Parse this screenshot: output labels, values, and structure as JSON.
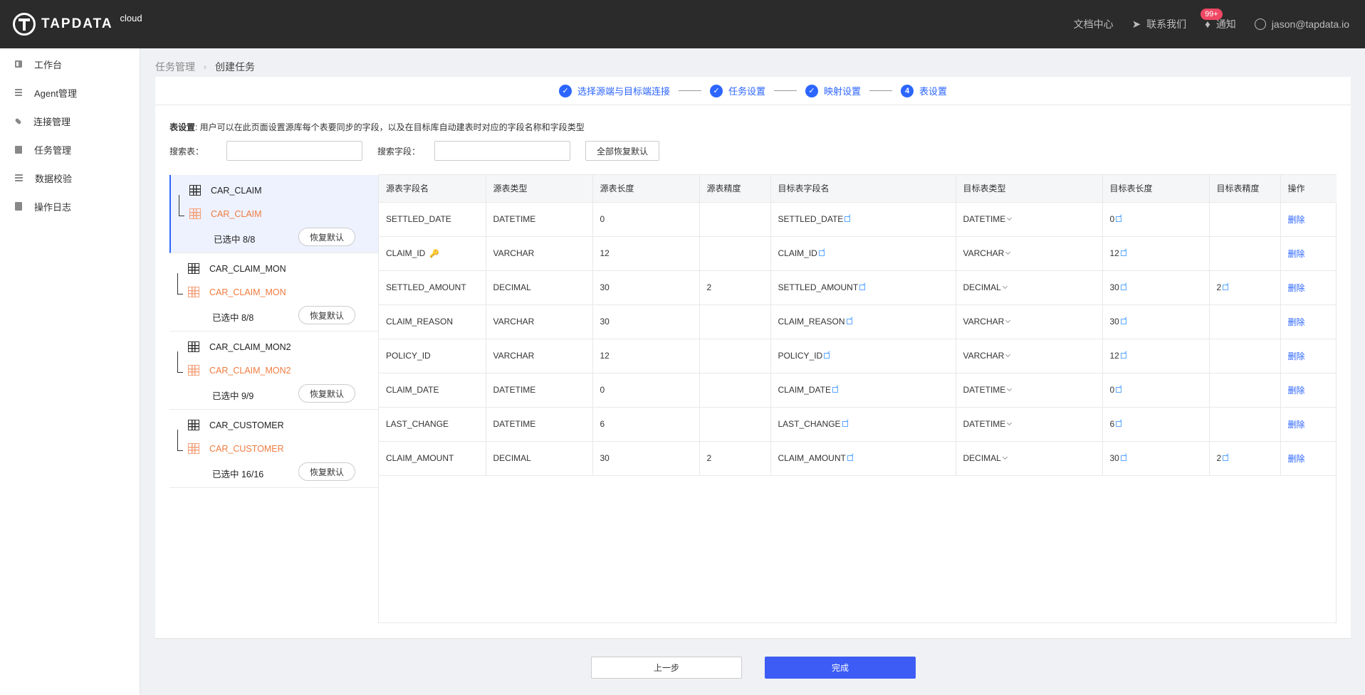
{
  "header": {
    "logo_text": "TAPDATA",
    "logo_sub": "cloud",
    "docs": "文档中心",
    "contact": "联系我们",
    "notify": "通知",
    "notify_badge": "99+",
    "user": "jason@tapdata.io"
  },
  "sidebar": {
    "items": [
      {
        "label": "工作台",
        "icon": "dashboard-icon"
      },
      {
        "label": "Agent管理",
        "icon": "agent-icon"
      },
      {
        "label": "连接管理",
        "icon": "link-icon"
      },
      {
        "label": "任务管理",
        "icon": "task-icon"
      },
      {
        "label": "数据校验",
        "icon": "verify-icon"
      },
      {
        "label": "操作日志",
        "icon": "log-icon"
      }
    ]
  },
  "breadcrumb": {
    "parent": "任务管理",
    "current": "创建任务"
  },
  "steps": [
    {
      "label": "选择源端与目标端连接",
      "state": "done"
    },
    {
      "label": "任务设置",
      "state": "done"
    },
    {
      "label": "映射设置",
      "state": "done"
    },
    {
      "label": "表设置",
      "state": "current",
      "number": "4"
    }
  ],
  "desc": {
    "title": "表设置",
    "text": ": 用户可以在此页面设置源库每个表要同步的字段，以及在目标库自动建表时对应的字段名称和字段类型"
  },
  "search": {
    "table_label": "搜索表：",
    "field_label": "搜索字段：",
    "table_value": "",
    "field_value": "",
    "reset_all": "全部恢复默认"
  },
  "tables": [
    {
      "source": "CAR_CLAIM",
      "target": "CAR_CLAIM",
      "selected": "已选中 8/8",
      "restore": "恢复默认",
      "active": true
    },
    {
      "source": "CAR_CLAIM_MON",
      "target": "CAR_CLAIM_MON",
      "selected": "已选中 8/8",
      "restore": "恢复默认",
      "active": false
    },
    {
      "source": "CAR_CLAIM_MON2",
      "target": "CAR_CLAIM_MON2",
      "selected": "已选中 9/9",
      "restore": "恢复默认",
      "active": false
    },
    {
      "source": "CAR_CUSTOMER",
      "target": "CAR_CUSTOMER",
      "selected": "已选中 16/16",
      "restore": "恢复默认",
      "active": false
    }
  ],
  "field_table": {
    "columns": [
      "源表字段名",
      "源表类型",
      "源表长度",
      "源表精度",
      "目标表字段名",
      "目标表类型",
      "目标表长度",
      "目标表精度",
      "操作"
    ],
    "rows": [
      {
        "src_name": "SETTLED_DATE",
        "src_type": "DATETIME",
        "src_len": "0",
        "src_prec": "",
        "tgt_name": "SETTLED_DATE",
        "tgt_type": "DATETIME",
        "tgt_len": "0",
        "tgt_prec": "",
        "key": false,
        "action": "删除"
      },
      {
        "src_name": "CLAIM_ID",
        "src_type": "VARCHAR",
        "src_len": "12",
        "src_prec": "",
        "tgt_name": "CLAIM_ID",
        "tgt_type": "VARCHAR",
        "tgt_len": "12",
        "tgt_prec": "",
        "key": true,
        "action": "删除"
      },
      {
        "src_name": "SETTLED_AMOUNT",
        "src_type": "DECIMAL",
        "src_len": "30",
        "src_prec": "2",
        "tgt_name": "SETTLED_AMOUNT",
        "tgt_type": "DECIMAL",
        "tgt_len": "30",
        "tgt_prec": "2",
        "key": false,
        "action": "删除"
      },
      {
        "src_name": "CLAIM_REASON",
        "src_type": "VARCHAR",
        "src_len": "30",
        "src_prec": "",
        "tgt_name": "CLAIM_REASON",
        "tgt_type": "VARCHAR",
        "tgt_len": "30",
        "tgt_prec": "",
        "key": false,
        "action": "删除"
      },
      {
        "src_name": "POLICY_ID",
        "src_type": "VARCHAR",
        "src_len": "12",
        "src_prec": "",
        "tgt_name": "POLICY_ID",
        "tgt_type": "VARCHAR",
        "tgt_len": "12",
        "tgt_prec": "",
        "key": false,
        "action": "删除"
      },
      {
        "src_name": "CLAIM_DATE",
        "src_type": "DATETIME",
        "src_len": "0",
        "src_prec": "",
        "tgt_name": "CLAIM_DATE",
        "tgt_type": "DATETIME",
        "tgt_len": "0",
        "tgt_prec": "",
        "key": false,
        "action": "删除"
      },
      {
        "src_name": "LAST_CHANGE",
        "src_type": "DATETIME",
        "src_len": "6",
        "src_prec": "",
        "tgt_name": "LAST_CHANGE",
        "tgt_type": "DATETIME",
        "tgt_len": "6",
        "tgt_prec": "",
        "key": false,
        "action": "删除"
      },
      {
        "src_name": "CLAIM_AMOUNT",
        "src_type": "DECIMAL",
        "src_len": "30",
        "src_prec": "2",
        "tgt_name": "CLAIM_AMOUNT",
        "tgt_type": "DECIMAL",
        "tgt_len": "30",
        "tgt_prec": "2",
        "key": false,
        "action": "删除"
      }
    ]
  },
  "footer": {
    "prev": "上一步",
    "finish": "完成"
  },
  "colors": {
    "accent": "#2c65ff",
    "header_bg": "#2b2b2b",
    "target_text": "#f07b3f",
    "finish_bg": "#3d5cf5"
  }
}
